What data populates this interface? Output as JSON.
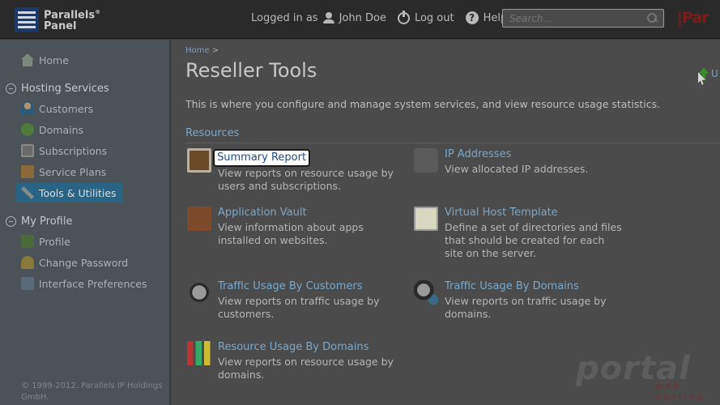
{
  "header": {
    "logo_line1": "Parallels",
    "logo_reg": "®",
    "logo_line2": "Panel",
    "logged_in_label": "Logged in as",
    "user_name": "John Doe",
    "logout_label": "Log out",
    "help_label": "Help",
    "search_placeholder": "Search...",
    "brand_right": "|Par"
  },
  "sidebar": {
    "home": "Home",
    "hosting_services": "Hosting Services",
    "customers": "Customers",
    "domains": "Domains",
    "subscriptions": "Subscriptions",
    "service_plans": "Service Plans",
    "tools_utilities": "Tools & Utilities",
    "my_profile": "My Profile",
    "profile": "Profile",
    "change_password": "Change Password",
    "interface_preferences": "Interface Preferences",
    "copyright": "© 1999-2012. Parallels IP Holdings GmbH."
  },
  "main": {
    "breadcrumb_home": "Home",
    "breadcrumb_sep": ">",
    "title": "Reseller Tools",
    "up_label": "U",
    "intro": "This is where you configure and manage system services, and view resource usage statistics.",
    "section_title": "Resources",
    "tools": [
      {
        "title": "Summary Report",
        "desc": "View reports on resource usage by users and subscriptions."
      },
      {
        "title": "IP Addresses",
        "desc": "View allocated IP addresses."
      },
      {
        "title": "Application Vault",
        "desc": "View information about apps installed on websites."
      },
      {
        "title": "Virtual Host Template",
        "desc": "Define a set of directories and files that should be created for each site on the server."
      },
      {
        "title": "Traffic Usage By Customers",
        "desc": "View reports on traffic usage by customers."
      },
      {
        "title": "Traffic Usage By Domains",
        "desc": "View reports on traffic usage by domains."
      },
      {
        "title": "Resource Usage By Domains",
        "desc": "View reports on resource usage by domains."
      }
    ]
  },
  "watermark": {
    "main": "portal",
    "sub": "web hosting"
  }
}
